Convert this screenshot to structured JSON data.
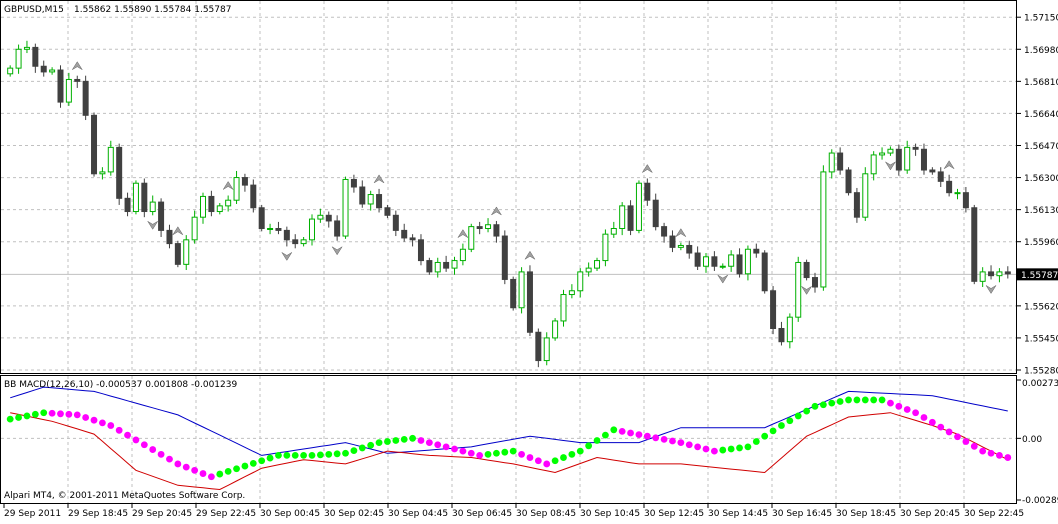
{
  "window": {
    "symbol_title": "GBPUSD,M15",
    "ohlc_readout": "1.55862 1.55890 1.55784 1.55787"
  },
  "indicator": {
    "label": "BB MACD(12,26,10) -0.000537 0.001808 -0.001239"
  },
  "copyright": "Alpari MT4, © 2001-2011 MetaQuotes Software Corp.",
  "colors": {
    "bull": "#00b000",
    "bear": "#404040",
    "upper_band": "#0000c8",
    "lower_band": "#d00000",
    "dots_up": "#00ff00",
    "dots_down": "#ff00ff"
  },
  "chart_data": [
    {
      "type": "candlestick",
      "ylim": [
        1.5528,
        1.5722
      ],
      "y_ticks": [
        "1.57150",
        "1.56980",
        "1.56810",
        "1.56640",
        "1.56470",
        "1.56300",
        "1.56130",
        "1.55960",
        "1.55787",
        "1.55620",
        "1.55450",
        "1.55280"
      ],
      "current_price": "1.55787",
      "x_ticks": [
        "29 Sep 2011",
        "29 Sep 18:45",
        "29 Sep 20:45",
        "29 Sep 22:45",
        "30 Sep 00:45",
        "30 Sep 02:45",
        "30 Sep 04:45",
        "30 Sep 06:45",
        "30 Sep 08:45",
        "30 Sep 10:45",
        "30 Sep 12:45",
        "30 Sep 14:45",
        "30 Sep 16:45",
        "30 Sep 18:45",
        "30 Sep 20:45",
        "30 Sep 22:45"
      ],
      "close": [
        1.5688,
        1.5698,
        1.5699,
        1.5689,
        1.5686,
        1.5687,
        1.567,
        1.5682,
        1.5681,
        1.5663,
        1.5632,
        1.5633,
        1.5646,
        1.5619,
        1.5612,
        1.5627,
        1.5612,
        1.5617,
        1.5602,
        1.5595,
        1.5584,
        1.5597,
        1.5609,
        1.562,
        1.5612,
        1.5615,
        1.5618,
        1.563,
        1.5626,
        1.5614,
        1.5603,
        1.5603,
        1.5602,
        1.5597,
        1.5595,
        1.5597,
        1.5608,
        1.561,
        1.5607,
        1.5599,
        1.5629,
        1.5625,
        1.5616,
        1.5621,
        1.5614,
        1.561,
        1.5602,
        1.5598,
        1.5597,
        1.5586,
        1.558,
        1.5585,
        1.5582,
        1.5586,
        1.5592,
        1.5604,
        1.5603,
        1.5605,
        1.5599,
        1.5576,
        1.5561,
        1.558,
        1.5548,
        1.5533,
        1.5545,
        1.5554,
        1.5568,
        1.557,
        1.558,
        1.5582,
        1.5586,
        1.56,
        1.5603,
        1.5615,
        1.5602,
        1.5627,
        1.5618,
        1.5604,
        1.5599,
        1.5593,
        1.5594,
        1.559,
        1.5583,
        1.5588,
        1.5583,
        1.5583,
        1.5589,
        1.5579,
        1.5592,
        1.559,
        1.557,
        1.555,
        1.5543,
        1.5556,
        1.5585,
        1.5577,
        1.5572,
        1.5633,
        1.5643,
        1.5634,
        1.5622,
        1.5609,
        1.5632,
        1.5642,
        1.5643,
        1.5645,
        1.5634,
        1.5646,
        1.5645,
        1.5634,
        1.5633,
        1.5628,
        1.5622,
        1.5622,
        1.5614,
        1.5575,
        1.558,
        1.5578,
        1.558,
        1.5579
      ]
    },
    {
      "type": "line",
      "ylim": [
        -0.00289,
        0.002734
      ],
      "y_ticks": [
        "0.002734",
        "0.00",
        "-0.00289"
      ],
      "series": [
        {
          "color": "upper",
          "x": [
            0,
            4,
            10,
            20,
            30,
            40,
            45,
            55,
            62,
            68,
            75,
            80,
            90,
            100,
            110,
            115,
            120
          ],
          "values": [
            0.0019,
            0.0024,
            0.0022,
            0.0011,
            -0.0008,
            -0.0002,
            -0.0007,
            -0.0004,
            0.0001,
            -0.0002,
            -0.0002,
            0.0005,
            0.0005,
            0.0022,
            0.002,
            0.0016,
            0.0012
          ]
        },
        {
          "color": "lower",
          "x": [
            0,
            5,
            10,
            15,
            20,
            25,
            30,
            35,
            40,
            45,
            50,
            55,
            60,
            65,
            70,
            75,
            80,
            85,
            90,
            95,
            100,
            105,
            110,
            113,
            116,
            120
          ],
          "values": [
            0.0012,
            0.0008,
            0.0002,
            -0.0015,
            -0.0022,
            -0.0024,
            -0.0014,
            -0.001,
            -0.0012,
            -0.0006,
            -0.0008,
            -0.0009,
            -0.0012,
            -0.0016,
            -0.0009,
            -0.0012,
            -0.0012,
            -0.0014,
            -0.0016,
            0.0001,
            0.001,
            0.0012,
            0.0006,
            0.0002,
            -0.0004,
            -0.0012
          ]
        }
      ],
      "dots": {
        "x": [
          0,
          4,
          8,
          12,
          16,
          20,
          24,
          28,
          32,
          36,
          40,
          44,
          48,
          52,
          56,
          60,
          64,
          68,
          72,
          76,
          80,
          84,
          88,
          92,
          96,
          100,
          104,
          108,
          112,
          116,
          120
        ],
        "values": [
          0.0009,
          0.0012,
          0.0011,
          0.0006,
          -0.0003,
          -0.0012,
          -0.0018,
          -0.0013,
          -0.0008,
          -0.0008,
          -0.0007,
          -0.0002,
          -0.0,
          -0.0004,
          -0.0008,
          -0.0006,
          -0.0012,
          -0.0006,
          0.0004,
          0.0001,
          -0.0002,
          -0.0006,
          -0.0004,
          0.0006,
          0.0015,
          0.0018,
          0.0018,
          0.0012,
          0.0003,
          -0.0006,
          -0.001
        ]
      }
    }
  ]
}
